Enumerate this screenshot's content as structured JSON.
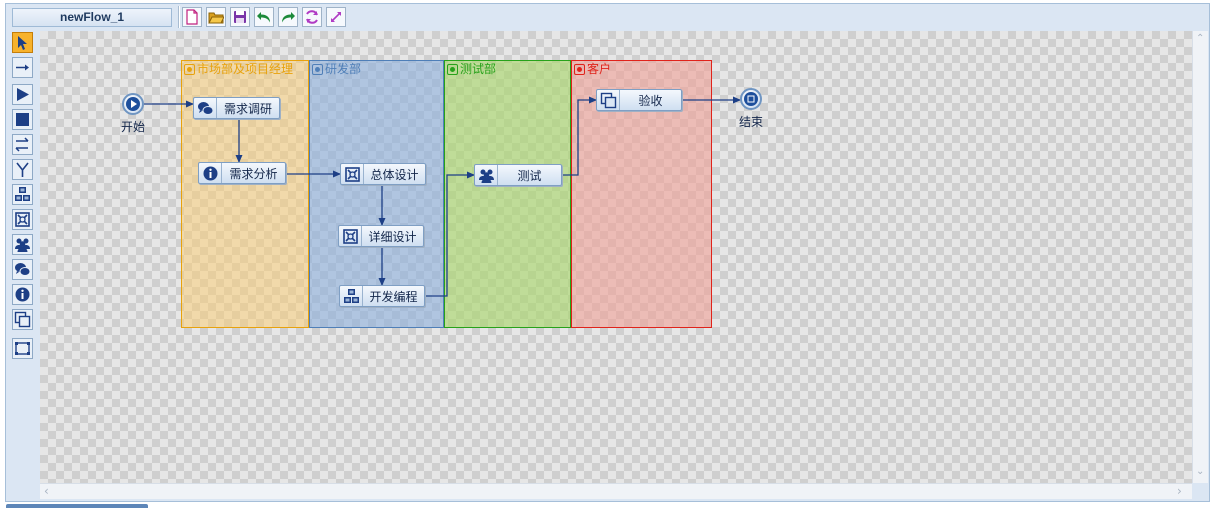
{
  "editor": {
    "flow_name": "newFlow_1"
  },
  "toolbar": {
    "buttons": [
      {
        "icon": "new-file-icon"
      },
      {
        "icon": "open-folder-icon"
      },
      {
        "icon": "save-icon"
      },
      {
        "icon": "undo-icon"
      },
      {
        "icon": "redo-icon"
      },
      {
        "icon": "refresh-icon"
      },
      {
        "icon": "fullscreen-icon"
      }
    ]
  },
  "palette": {
    "tools": [
      {
        "icon": "select-pointer-icon",
        "active": true
      },
      {
        "icon": "transition-arrow-icon"
      },
      {
        "icon": "start-node-icon"
      },
      {
        "icon": "end-node-icon"
      },
      {
        "icon": "fork-join-icon"
      },
      {
        "icon": "branch-icon"
      },
      {
        "icon": "subflow-icon"
      },
      {
        "icon": "task-icon"
      },
      {
        "icon": "users-icon"
      },
      {
        "icon": "discussion-icon"
      },
      {
        "icon": "info-icon"
      },
      {
        "icon": "copy-icon"
      },
      {
        "icon": "container-icon"
      }
    ]
  },
  "diagram": {
    "lanes": [
      {
        "label": "市场部及项目经理",
        "color": "#e8a20c",
        "fill": "rgba(250,205,120,0.55)"
      },
      {
        "label": "研发部",
        "color": "#4f7fb8",
        "fill": "rgba(140,175,220,0.6)"
      },
      {
        "label": "测试部",
        "color": "#27a21a",
        "fill": "rgba(170,215,110,0.65)"
      },
      {
        "label": "客户",
        "color": "#e0231b",
        "fill": "rgba(240,160,150,0.6)"
      }
    ],
    "start": {
      "label": "开始"
    },
    "end": {
      "label": "结束"
    },
    "nodes": [
      {
        "label": "需求调研",
        "icon": "discussion-icon"
      },
      {
        "label": "需求分析",
        "icon": "info-icon"
      },
      {
        "label": "总体设计",
        "icon": "task-icon"
      },
      {
        "label": "详细设计",
        "icon": "task-icon"
      },
      {
        "label": "开发编程",
        "icon": "subflow-icon"
      },
      {
        "label": "测试",
        "icon": "users-icon"
      },
      {
        "label": "验收",
        "icon": "copy-icon"
      }
    ]
  }
}
